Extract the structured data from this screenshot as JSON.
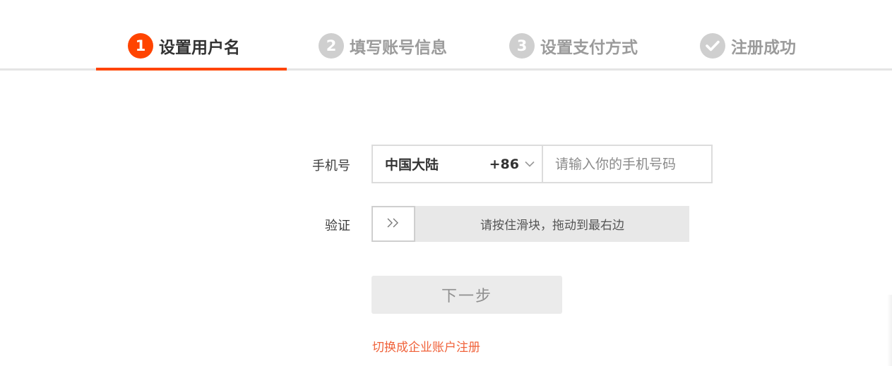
{
  "steps": [
    {
      "number": "1",
      "label": "设置用户名",
      "icon": "step-number",
      "active": true
    },
    {
      "number": "2",
      "label": "填写账号信息",
      "icon": "step-number",
      "active": false
    },
    {
      "number": "3",
      "label": "设置支付方式",
      "icon": "step-number",
      "active": false
    },
    {
      "number": "",
      "label": "注册成功",
      "icon": "checkmark-icon",
      "active": false
    }
  ],
  "form": {
    "phone_label": "手机号",
    "country_name": "中国大陆",
    "country_code": "+86",
    "phone_placeholder": "请输入你的手机号码",
    "phone_value": "",
    "verify_label": "验证",
    "slider_hint": "请按住滑块，拖动到最右边",
    "slider_icon": "double-chevron-right-icon",
    "next_label": "下一步",
    "switch_link": "切换成企业账户注册"
  },
  "colors": {
    "accent": "#ff4400",
    "inactive_step": "#cfcfcf",
    "link": "#f0623a"
  }
}
